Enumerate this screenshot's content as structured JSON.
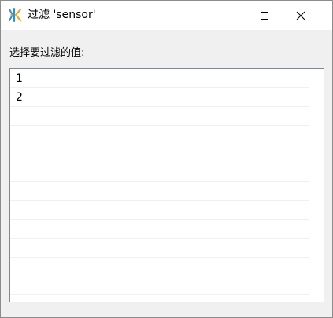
{
  "window": {
    "title": "过滤 'sensor'",
    "app_icon": "app-logo-icon",
    "controls": {
      "minimize_icon": "minimize-icon",
      "maximize_icon": "maximize-icon",
      "close_icon": "close-icon"
    }
  },
  "dialog": {
    "prompt_label": "选择要过滤的值:",
    "values": [
      {
        "label": "1"
      },
      {
        "label": "2"
      },
      {
        "label": ""
      },
      {
        "label": ""
      },
      {
        "label": ""
      },
      {
        "label": ""
      },
      {
        "label": ""
      },
      {
        "label": ""
      },
      {
        "label": ""
      },
      {
        "label": ""
      },
      {
        "label": ""
      },
      {
        "label": ""
      }
    ]
  },
  "colors": {
    "icon_blue": "#2f8fd6",
    "icon_orange": "#f5a623",
    "window_background": "#f0f0f0",
    "titlebar_background": "#ffffff",
    "list_border": "#828790"
  }
}
